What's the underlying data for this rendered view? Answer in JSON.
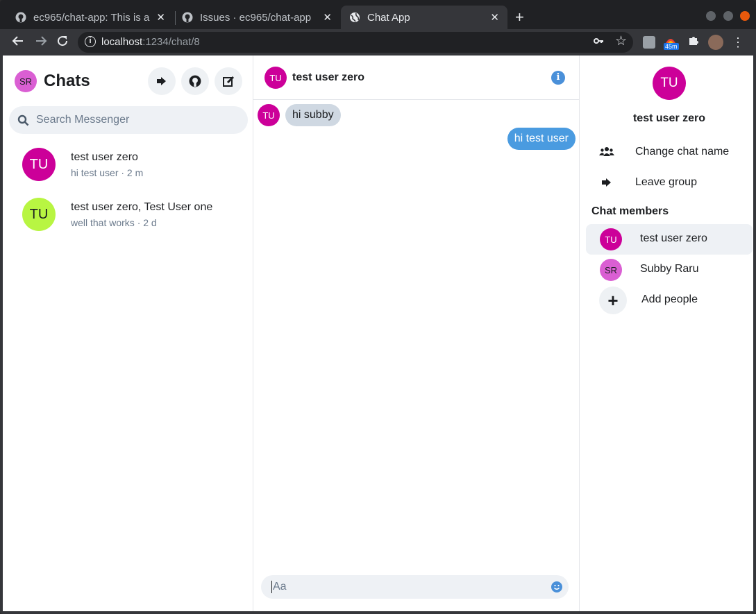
{
  "browser": {
    "tabs": [
      {
        "title": "ec965/chat-app: This is a",
        "close": "✕"
      },
      {
        "title": "Issues · ec965/chat-app",
        "close": "✕"
      },
      {
        "title": "Chat App",
        "close": "✕"
      }
    ],
    "new_tab": "+",
    "url_host": "localhost",
    "url_path": ":1234/chat/8",
    "extension_badge": "45m"
  },
  "sidebar": {
    "user_initials": "SR",
    "title": "Chats",
    "search_placeholder": "Search Messenger",
    "conversations": [
      {
        "initials": "TU",
        "name": "test user zero",
        "preview": "hi test user · 2 m",
        "color": "#cc0099"
      },
      {
        "initials": "TU",
        "name": "test user zero, Test User one",
        "preview": "well that works · 2 d",
        "color": "#b8f542"
      }
    ]
  },
  "chat": {
    "header_initials": "TU",
    "header_name": "test user zero",
    "messages": [
      {
        "initials": "TU",
        "text": "hi subby",
        "from": "other"
      },
      {
        "text": "hi test user",
        "from": "me"
      }
    ],
    "composer_placeholder": "Aa"
  },
  "details": {
    "initials": "TU",
    "name": "test user zero",
    "actions": [
      {
        "label": "Change chat name",
        "icon": "users-icon"
      },
      {
        "label": "Leave group",
        "icon": "sign-out-icon"
      }
    ],
    "members_heading": "Chat members",
    "members": [
      {
        "initials": "TU",
        "name": "test user zero",
        "color": "#cc0099"
      },
      {
        "initials": "SR",
        "name": "Subby Raru",
        "color": "#da5fd3"
      }
    ],
    "add_people": "Add people"
  },
  "colors": {
    "accent_blue": "#4a90d9",
    "magenta": "#cc0099",
    "lime": "#b8f542",
    "orchid": "#da5fd3"
  }
}
